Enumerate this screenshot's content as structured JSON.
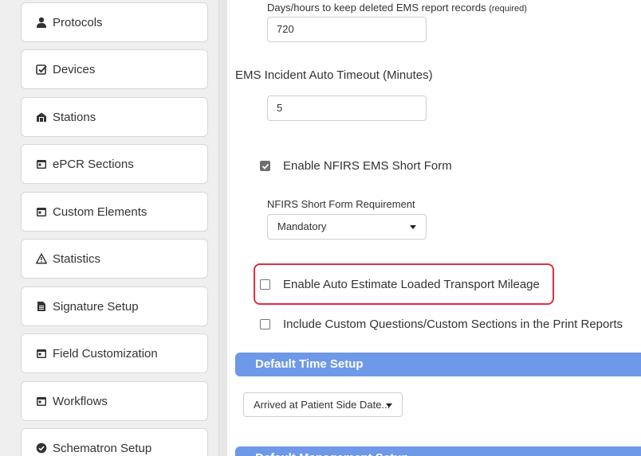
{
  "sidebar": {
    "items": [
      {
        "label": "Protocols",
        "icon": "user-icon"
      },
      {
        "label": "Devices",
        "icon": "checkbox-icon"
      },
      {
        "label": "Stations",
        "icon": "building-icon"
      },
      {
        "label": "ePCR Sections",
        "icon": "window-icon"
      },
      {
        "label": "Custom Elements",
        "icon": "window-icon"
      },
      {
        "label": "Statistics",
        "icon": "warning-icon"
      },
      {
        "label": "Signature Setup",
        "icon": "document-icon"
      },
      {
        "label": "Field Customization",
        "icon": "window-icon"
      },
      {
        "label": "Workflows",
        "icon": "window-icon"
      },
      {
        "label": "Schematron Setup",
        "icon": "badge-check-icon"
      }
    ]
  },
  "main": {
    "deleted_days_label": "Days/hours to keep deleted EMS report records",
    "deleted_days_required": "(required)",
    "deleted_days_value": "720",
    "auto_timeout_label": "EMS Incident Auto Timeout (Minutes)",
    "auto_timeout_value": "5",
    "nfirs_short_form_label": "Enable NFIRS EMS Short Form",
    "nfirs_short_form_checked": true,
    "nfirs_requirement_label": "NFIRS Short Form Requirement",
    "nfirs_requirement_value": "Mandatory",
    "auto_mileage_label": "Enable Auto Estimate Loaded Transport Mileage",
    "auto_mileage_checked": false,
    "include_custom_label": "Include Custom Questions/Custom Sections in the Print Reports",
    "include_custom_checked": false,
    "default_time_header": "Default Time Setup",
    "default_time_value": "Arrived at Patient Side Date...",
    "next_section_header": "Default Management Setup"
  },
  "colors": {
    "section_bar": "#6e98e8",
    "highlight_border": "#e0303f"
  }
}
